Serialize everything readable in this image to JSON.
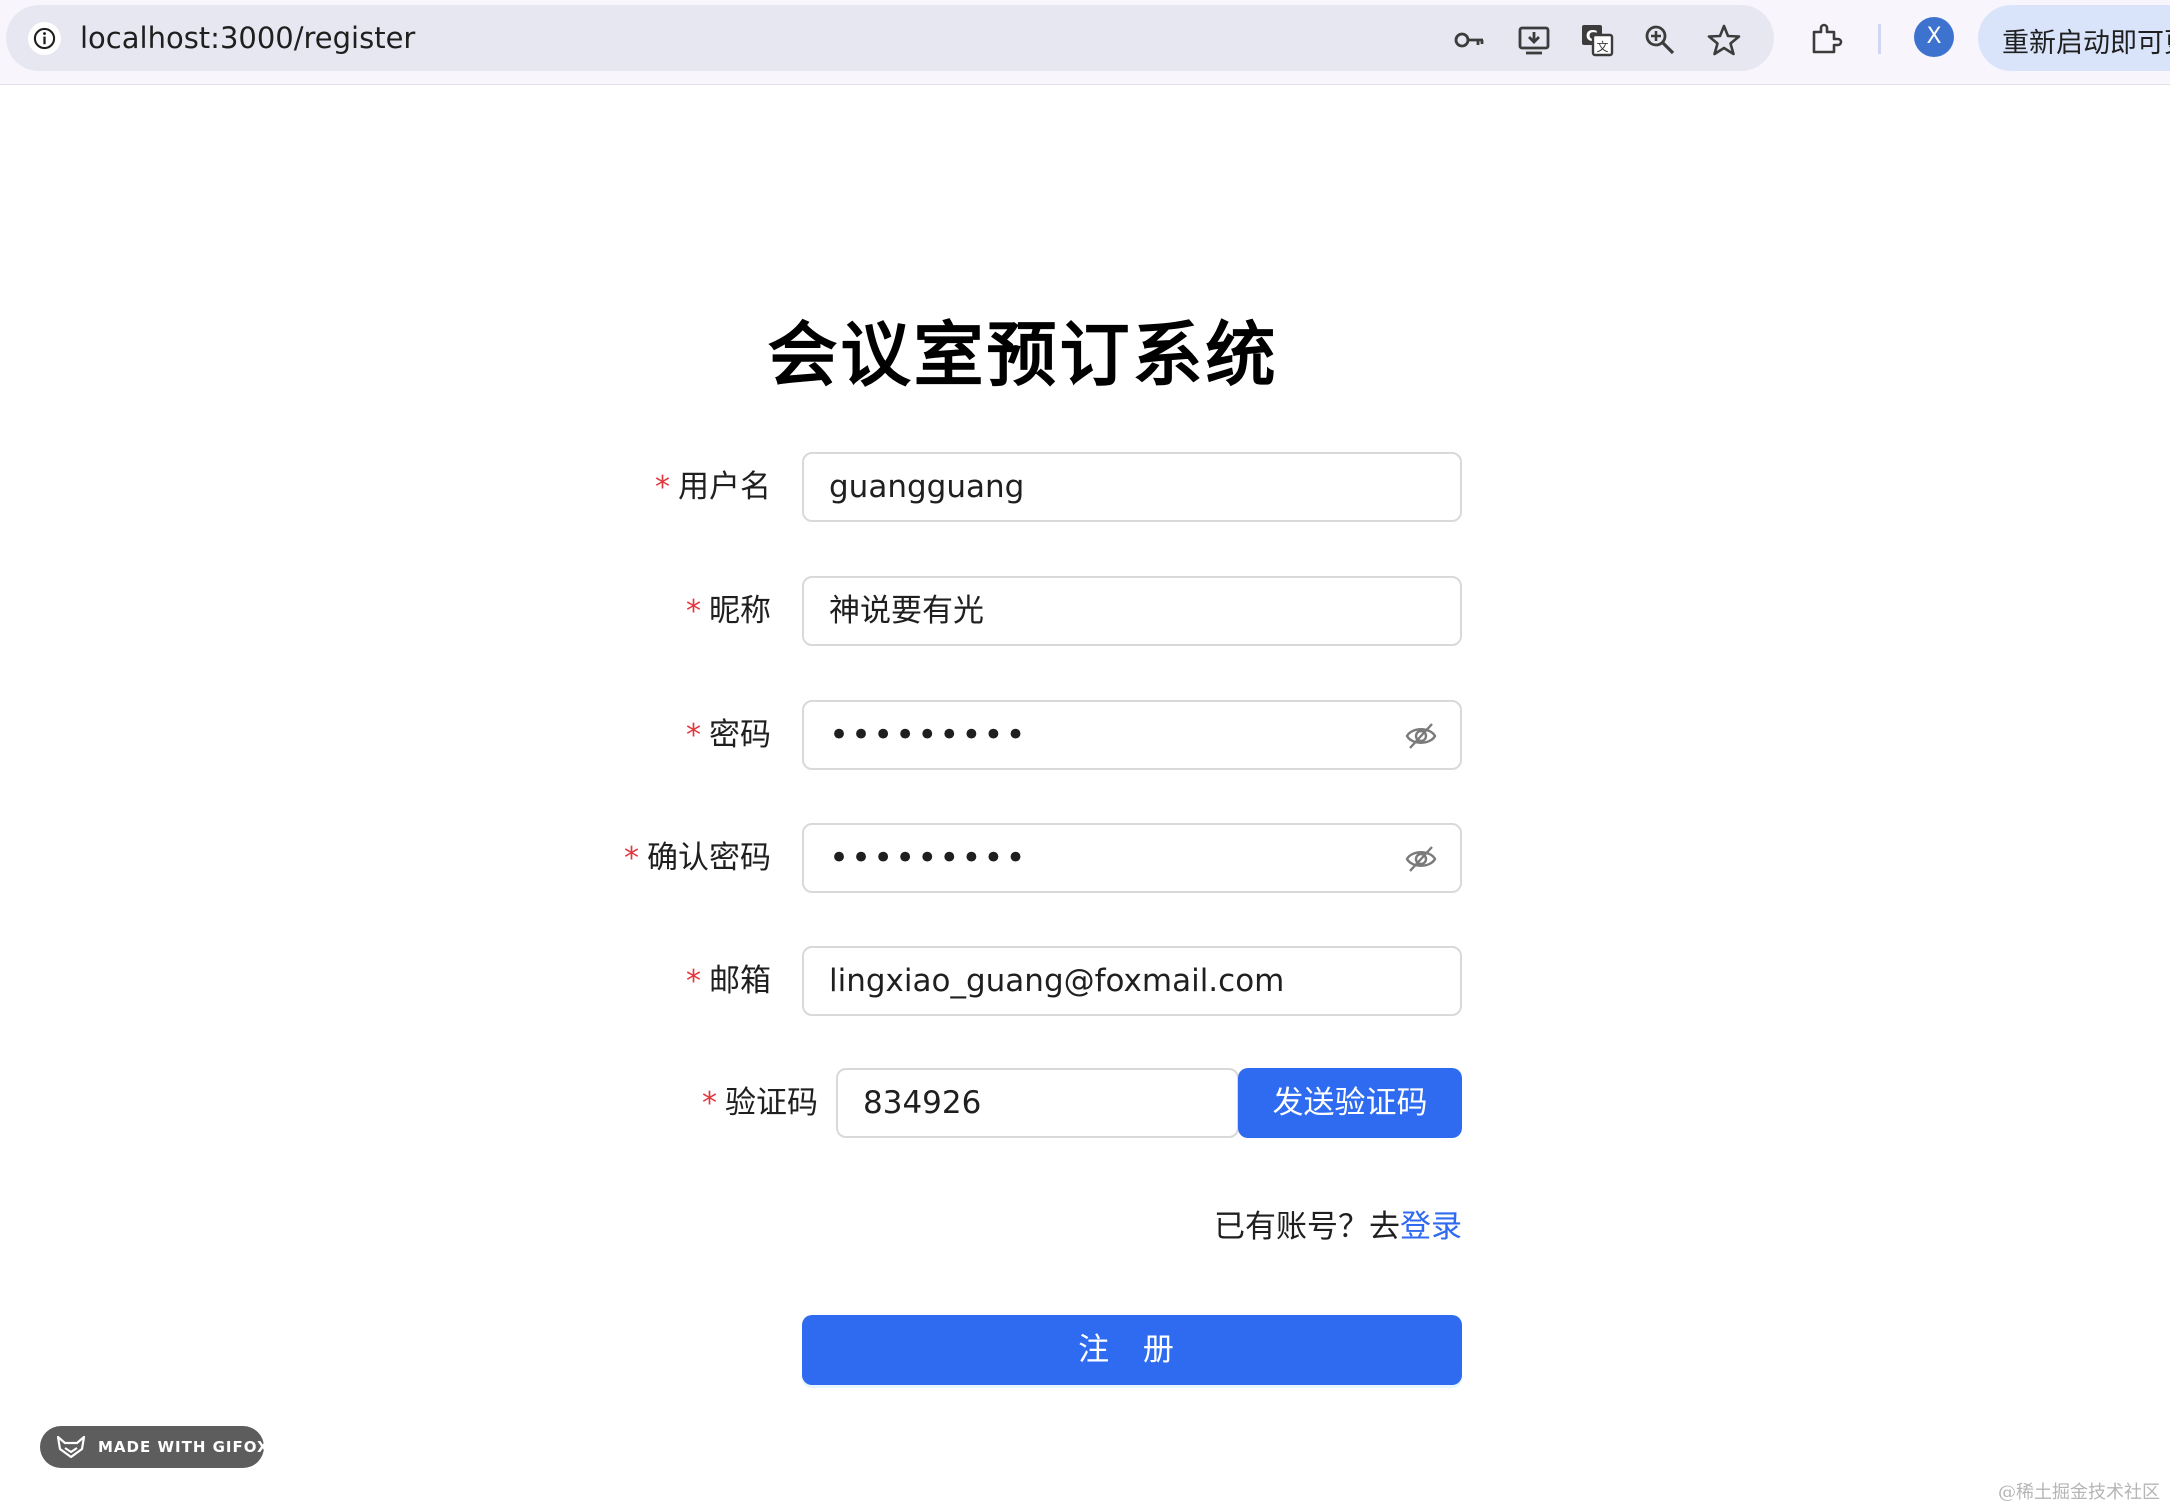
{
  "browser": {
    "url": "localhost:3000/register",
    "profile_initial": "X",
    "update_button": "重新启动即可更",
    "icons": [
      "info-icon",
      "key-icon",
      "install-icon",
      "translate-icon",
      "zoom-icon",
      "star-icon",
      "extensions-icon"
    ]
  },
  "page": {
    "title": "会议室预订系统"
  },
  "form": {
    "required_mark": "*",
    "username": {
      "label": "用户名",
      "value": "guangguang"
    },
    "nickname": {
      "label": "昵称",
      "value": "神说要有光"
    },
    "password": {
      "label": "密码",
      "value": "•••••••••"
    },
    "confirm_password": {
      "label": "确认密码",
      "value": "•••••••••"
    },
    "email": {
      "label": "邮箱",
      "value": "lingxiao_guang@foxmail.com"
    },
    "captcha": {
      "label": "验证码",
      "value": "834926",
      "send_button": "发送验证码"
    },
    "login_prompt": "已有账号？去",
    "login_link": "登录",
    "submit_button": "注 册"
  },
  "overlay": {
    "gifox_badge": "MADE WITH GIFOX",
    "watermark": "@稀土掘金技术社区"
  },
  "colors": {
    "primary": "#2f6bf0",
    "required": "#e0383e",
    "chrome_bg": "#f8f6fc",
    "omnibox_bg": "#e7e7f1"
  }
}
